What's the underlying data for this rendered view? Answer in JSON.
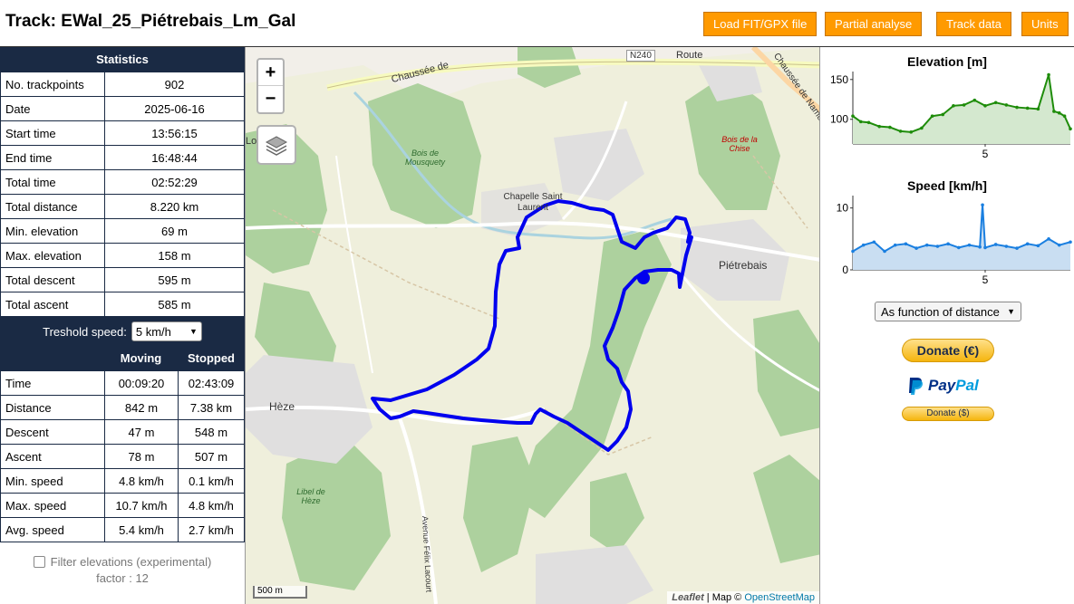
{
  "header": {
    "title_prefix": "Track: ",
    "track_name": "EWal_25_Piétrebais_Lm_Gal",
    "buttons": {
      "load": "Load FIT/GPX file",
      "partial": "Partial analyse",
      "track_data": "Track data",
      "units": "Units"
    }
  },
  "statistics": {
    "title": "Statistics",
    "rows": [
      {
        "label": "No. trackpoints",
        "value": "902"
      },
      {
        "label": "Date",
        "value": "2025-06-16"
      },
      {
        "label": "Start time",
        "value": "13:56:15"
      },
      {
        "label": "End time",
        "value": "16:48:44"
      },
      {
        "label": "Total time",
        "value": "02:52:29"
      },
      {
        "label": "Total distance",
        "value": "8.220 km"
      },
      {
        "label": "Min. elevation",
        "value": "69 m"
      },
      {
        "label": "Max. elevation",
        "value": "158 m"
      },
      {
        "label": "Total descent",
        "value": "595 m"
      },
      {
        "label": "Total ascent",
        "value": "585 m"
      }
    ],
    "threshold_label": "Treshold speed:",
    "threshold_value": "5 km/h",
    "moving_header": "Moving",
    "stopped_header": "Stopped",
    "ms_rows": [
      {
        "label": "Time",
        "moving": "00:09:20",
        "stopped": "02:43:09"
      },
      {
        "label": "Distance",
        "moving": "842 m",
        "stopped": "7.38 km"
      },
      {
        "label": "Descent",
        "moving": "47 m",
        "stopped": "548 m"
      },
      {
        "label": "Ascent",
        "moving": "78 m",
        "stopped": "507 m"
      },
      {
        "label": "Min. speed",
        "moving": "4.8 km/h",
        "stopped": "0.1 km/h"
      },
      {
        "label": "Max. speed",
        "moving": "10.7 km/h",
        "stopped": "4.8 km/h"
      },
      {
        "label": "Avg. speed",
        "moving": "5.4 km/h",
        "stopped": "2.7 km/h"
      }
    ],
    "filter_label": "Filter elevations (experimental)",
    "filter_factor": "factor : 12"
  },
  "map": {
    "zoom_in": "+",
    "zoom_out": "−",
    "scale": "500 m",
    "attribution_leaflet": "Leaflet",
    "attribution_sep": " | Map © ",
    "attribution_osm": "OpenStreetMap",
    "labels": {
      "n240": "N240",
      "chaussee1": "Chaussée de",
      "chaussee2": "Chaussée de Namur",
      "route": "Route",
      "bois_mousquety": "Bois de Mousquety",
      "bois_chise": "Bois de la Chise",
      "chapelle": "Chapelle Saint Laurent",
      "pietrebais": "Piétrebais",
      "heze": "Hèze",
      "libel": "Libel de Hèze",
      "avenue": "Avenue Félix Lacourt",
      "lo": "Lo"
    },
    "colors": {
      "track": "#0000ee",
      "forest": "#add19e",
      "road": "#ffffff",
      "water": "#aad3df"
    }
  },
  "charts": {
    "elevation": {
      "title": "Elevation [m]",
      "yticks": [
        "150",
        "100"
      ],
      "xticks": [
        "5"
      ],
      "color": "#1e8c0a",
      "fill": "#d4e8cf"
    },
    "speed": {
      "title": "Speed [km/h]",
      "yticks": [
        "10",
        "0"
      ],
      "xticks": [
        "5"
      ],
      "color": "#1a7fe0",
      "fill": "#c9def2"
    },
    "mode_select": "As function of distance"
  },
  "chart_data": [
    {
      "type": "area",
      "title": "Elevation [m]",
      "xlabel": "",
      "ylabel": "",
      "xlim": [
        0,
        8.22
      ],
      "ylim": [
        69,
        160
      ],
      "x": [
        0,
        0.3,
        0.6,
        1.0,
        1.4,
        1.8,
        2.2,
        2.6,
        3.0,
        3.4,
        3.8,
        4.2,
        4.6,
        5.0,
        5.4,
        5.8,
        6.2,
        6.6,
        7.0,
        7.4,
        7.6,
        7.8,
        8.0,
        8.22
      ],
      "y": [
        104,
        97,
        96,
        91,
        90,
        85,
        84,
        89,
        104,
        106,
        117,
        118,
        124,
        117,
        121,
        118,
        115,
        114,
        113,
        156,
        110,
        108,
        104,
        88
      ]
    },
    {
      "type": "area",
      "title": "Speed [km/h]",
      "xlabel": "",
      "ylabel": "",
      "xlim": [
        0,
        8.22
      ],
      "ylim": [
        0,
        12
      ],
      "x": [
        0,
        0.4,
        0.8,
        1.2,
        1.6,
        2.0,
        2.4,
        2.8,
        3.2,
        3.6,
        4.0,
        4.4,
        4.8,
        4.9,
        5.0,
        5.4,
        5.8,
        6.2,
        6.6,
        7.0,
        7.4,
        7.8,
        8.22
      ],
      "y": [
        3,
        4,
        4.5,
        3,
        4,
        4.2,
        3.5,
        4,
        3.8,
        4.2,
        3.6,
        4,
        3.7,
        10.5,
        3.6,
        4.1,
        3.8,
        3.5,
        4.2,
        3.9,
        5,
        4,
        4.5
      ]
    }
  ]
}
